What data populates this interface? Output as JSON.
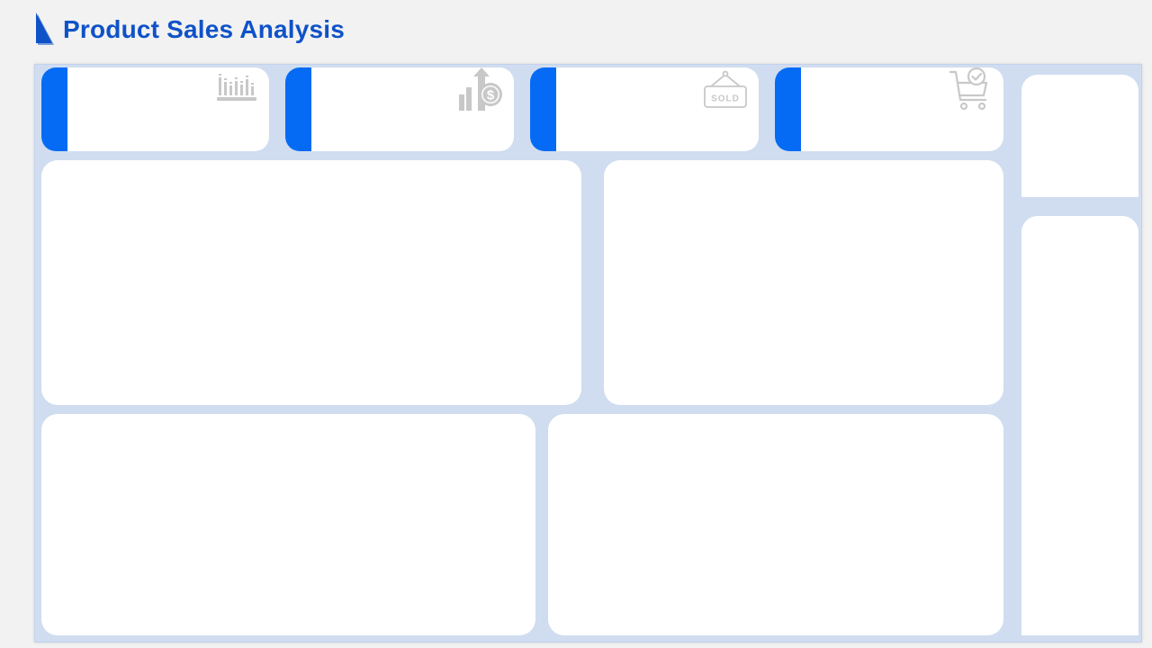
{
  "header": {
    "title": "Product Sales Analysis"
  },
  "colors": {
    "title": "#0f52c8",
    "accent": "#066bf4",
    "frame_background": "#d0ddf0",
    "page_background": "#f2f2f2",
    "card_background": "#ffffff",
    "icon_gray": "#c8c8c8"
  },
  "kpi_cards": [
    {
      "icon": "bar-chart-icon"
    },
    {
      "icon": "revenue-growth-icon"
    },
    {
      "icon": "sold-sign-icon",
      "icon_text": "SOLD"
    },
    {
      "icon": "shopping-cart-check-icon"
    }
  ]
}
